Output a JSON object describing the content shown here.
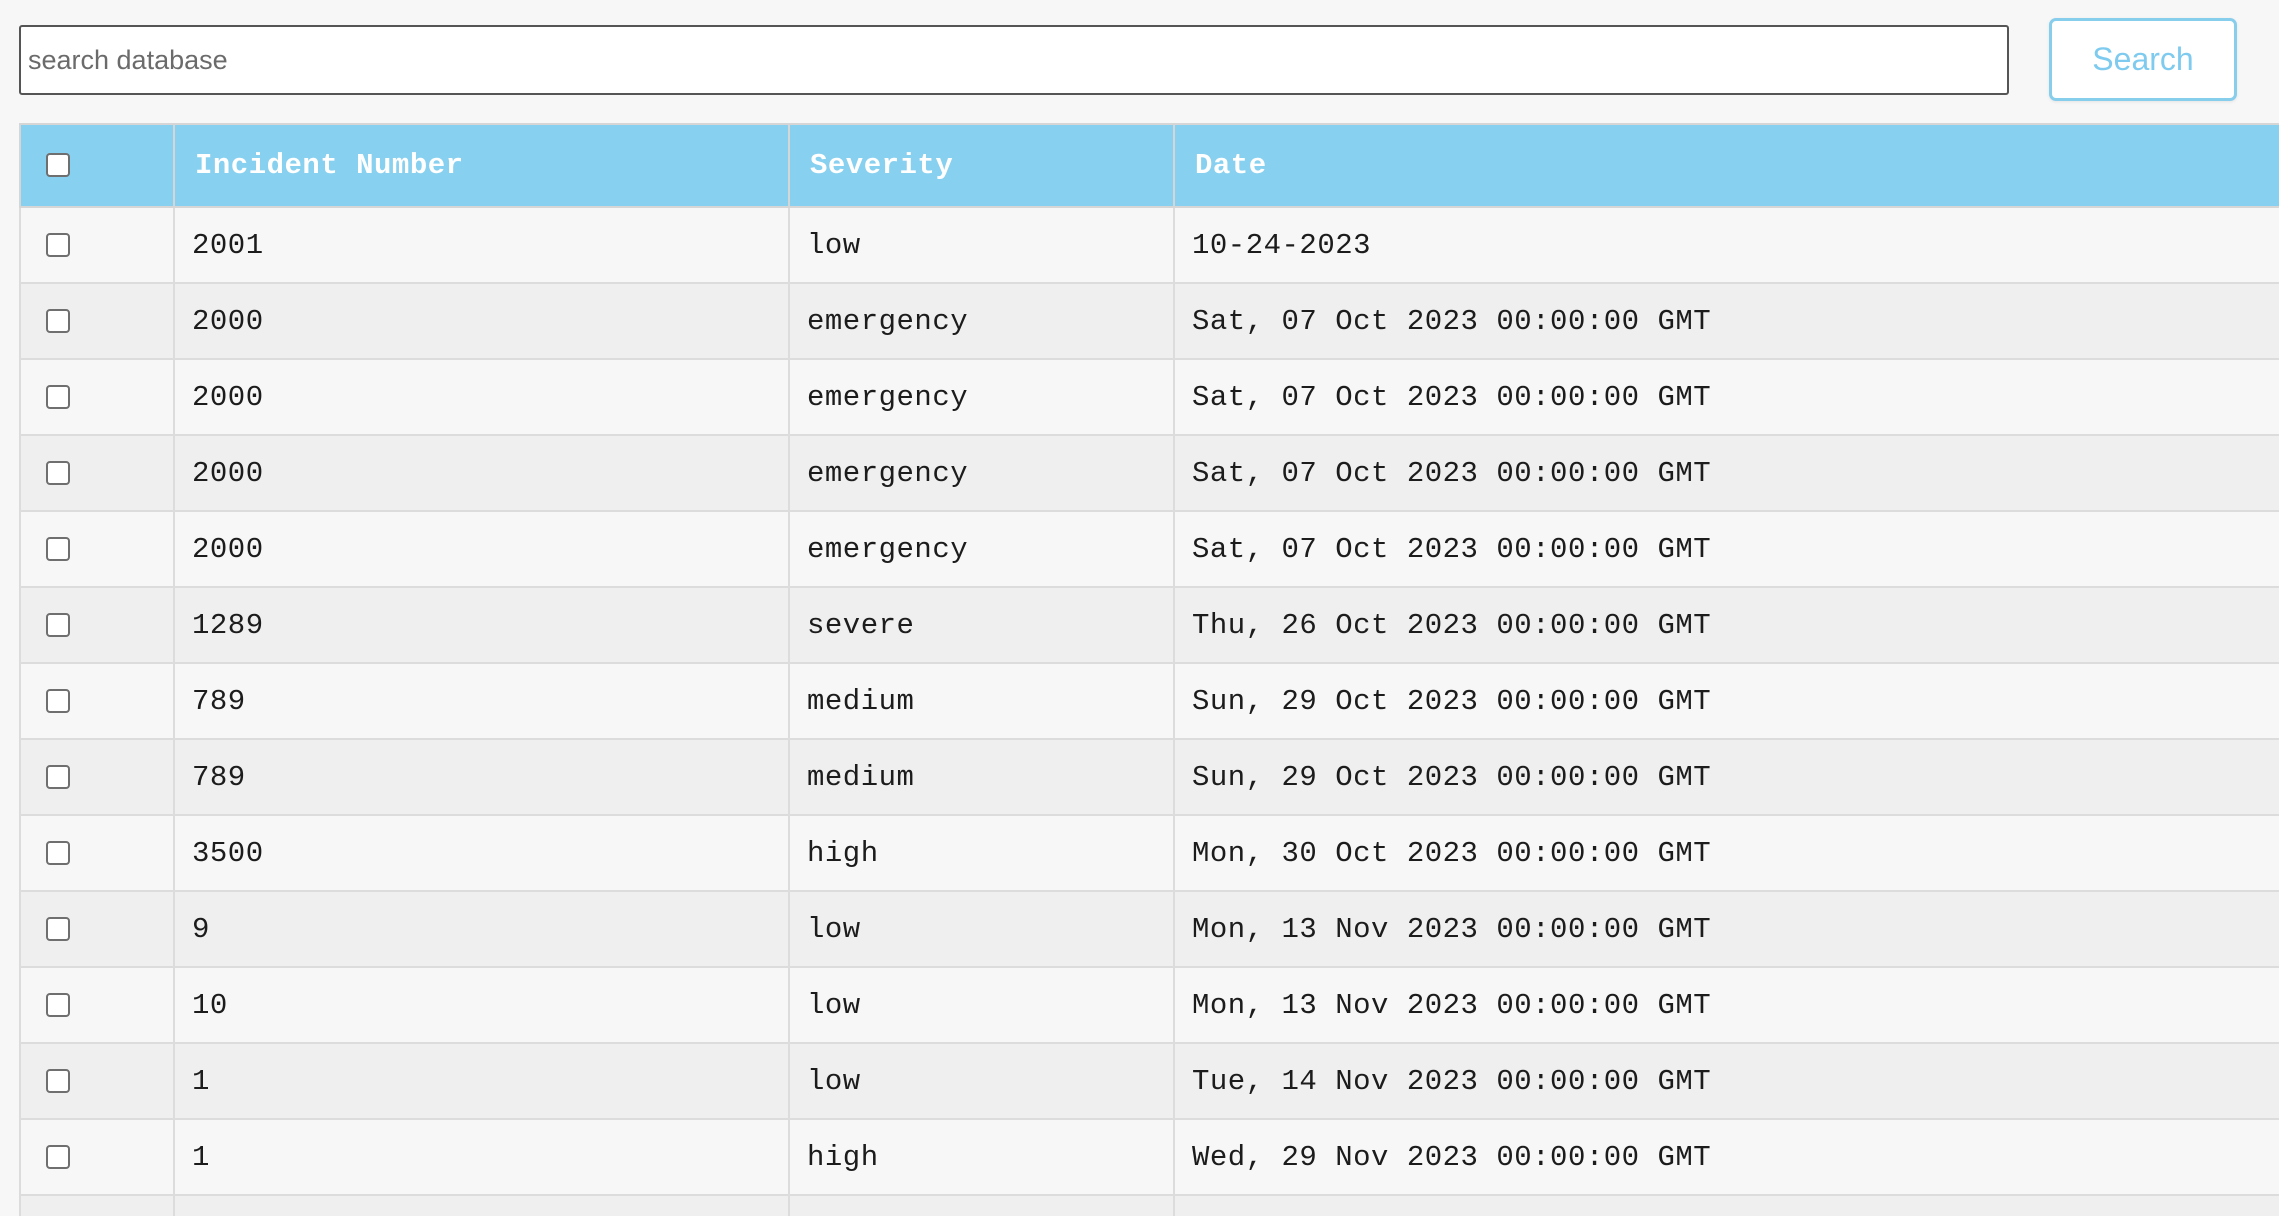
{
  "search": {
    "placeholder": "search database",
    "value": "",
    "button_label": "Search"
  },
  "table": {
    "columns": [
      "Incident Number",
      "Severity",
      "Date"
    ],
    "rows": [
      {
        "incident_number": "2001",
        "severity": "low",
        "date": "10-24-2023"
      },
      {
        "incident_number": "2000",
        "severity": "emergency",
        "date": "Sat, 07 Oct 2023 00:00:00 GMT"
      },
      {
        "incident_number": "2000",
        "severity": "emergency",
        "date": "Sat, 07 Oct 2023 00:00:00 GMT"
      },
      {
        "incident_number": "2000",
        "severity": "emergency",
        "date": "Sat, 07 Oct 2023 00:00:00 GMT"
      },
      {
        "incident_number": "2000",
        "severity": "emergency",
        "date": "Sat, 07 Oct 2023 00:00:00 GMT"
      },
      {
        "incident_number": "1289",
        "severity": "severe",
        "date": "Thu, 26 Oct 2023 00:00:00 GMT"
      },
      {
        "incident_number": "789",
        "severity": "medium",
        "date": "Sun, 29 Oct 2023 00:00:00 GMT"
      },
      {
        "incident_number": "789",
        "severity": "medium",
        "date": "Sun, 29 Oct 2023 00:00:00 GMT"
      },
      {
        "incident_number": "3500",
        "severity": "high",
        "date": "Mon, 30 Oct 2023 00:00:00 GMT"
      },
      {
        "incident_number": "9",
        "severity": "low",
        "date": "Mon, 13 Nov 2023 00:00:00 GMT"
      },
      {
        "incident_number": "10",
        "severity": "low",
        "date": "Mon, 13 Nov 2023 00:00:00 GMT"
      },
      {
        "incident_number": "1",
        "severity": "low",
        "date": "Tue, 14 Nov 2023 00:00:00 GMT"
      },
      {
        "incident_number": "1",
        "severity": "high",
        "date": "Wed, 29 Nov 2023 00:00:00 GMT"
      },
      {
        "incident_number": "",
        "severity": "",
        "date": ""
      }
    ]
  },
  "colors": {
    "header_background": "#87d0ef",
    "header_text": "#ffffff",
    "button_accent": "#7ecbef",
    "row_odd": "#f7f7f7",
    "row_even": "#efefef"
  }
}
